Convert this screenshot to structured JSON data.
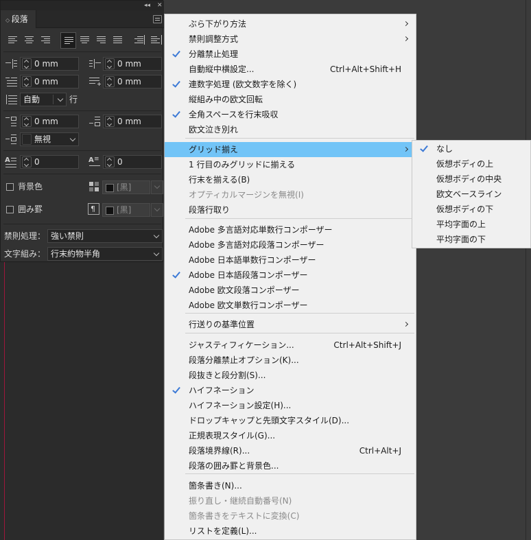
{
  "panel": {
    "title": "段落",
    "topbar_icons": [
      "collapse-icon",
      "close-icon"
    ],
    "indent_left": "0 mm",
    "indent_right": "0 mm",
    "indent_first": "0 mm",
    "indent_last": "0 mm",
    "leading_auto": "自動",
    "leading_unit": "行",
    "space_before": "0 mm",
    "space_after": "0 mm",
    "grid_align": "無視",
    "drop_cap_lines": "0",
    "drop_cap_chars": "0",
    "shading_label": "背景色",
    "shading_swatch": "[黒]",
    "border_label": "囲み罫",
    "border_swatch": "[黒]",
    "kinsoku_label": "禁則処理：",
    "kinsoku_value": "強い禁則",
    "mojikumi_label": "文字組み：",
    "mojikumi_value": "行末約物半角"
  },
  "menu": {
    "items": [
      {
        "label": "ぶら下がり方法",
        "submenu": true
      },
      {
        "label": "禁則調整方式",
        "submenu": true
      },
      {
        "label": "分離禁止処理",
        "checked": true
      },
      {
        "label": "自動縦中横設定...",
        "shortcut": "Ctrl+Alt+Shift+H"
      },
      {
        "label": "連数字処理 (欧文数字を除く)",
        "checked": true
      },
      {
        "label": "縦組み中の欧文回転"
      },
      {
        "label": "全角スペースを行末吸収",
        "checked": true
      },
      {
        "label": "欧文泣き別れ"
      },
      {
        "label": "グリッド揃え",
        "submenu": true,
        "highlighted": true
      },
      {
        "label": "1 行目のみグリッドに揃える"
      },
      {
        "label": "行末を揃える(B)"
      },
      {
        "label": "オプティカルマージンを無視(I)",
        "disabled": true
      },
      {
        "label": "段落行取り"
      },
      {
        "label": "Adobe 多言語対応単数行コンポーザー"
      },
      {
        "label": "Adobe 多言語対応段落コンポーザー"
      },
      {
        "label": "Adobe 日本語単数行コンポーザー"
      },
      {
        "label": "Adobe 日本語段落コンポーザー",
        "checked": true
      },
      {
        "label": "Adobe 欧文段落コンポーザー"
      },
      {
        "label": "Adobe 欧文単数行コンポーザー"
      },
      {
        "label": "行送りの基準位置",
        "submenu": true
      },
      {
        "label": "ジャスティフィケーション...",
        "shortcut": "Ctrl+Alt+Shift+J"
      },
      {
        "label": "段落分離禁止オプション(K)..."
      },
      {
        "label": "段抜きと段分割(S)..."
      },
      {
        "label": "ハイフネーション",
        "checked": true
      },
      {
        "label": "ハイフネーション設定(H)..."
      },
      {
        "label": "ドロップキャップと先頭文字スタイル(D)..."
      },
      {
        "label": "正規表現スタイル(G)..."
      },
      {
        "label": "段落境界線(R)...",
        "shortcut": "Ctrl+Alt+J"
      },
      {
        "label": "段落の囲み罫と背景色..."
      },
      {
        "label": "箇条書き(N)..."
      },
      {
        "label": "振り直し・継続自動番号(N)",
        "disabled": true
      },
      {
        "label": "箇条書きをテキストに変換(C)",
        "disabled": true
      },
      {
        "label": "リストを定義(L)..."
      }
    ]
  },
  "submenu": {
    "items": [
      {
        "label": "なし",
        "checked": true
      },
      {
        "label": "仮想ボディの上"
      },
      {
        "label": "仮想ボディの中央"
      },
      {
        "label": "欧文ベースライン"
      },
      {
        "label": "仮想ボディの下"
      },
      {
        "label": "平均字面の上"
      },
      {
        "label": "平均字面の下"
      }
    ]
  },
  "colors": {
    "highlight": "#72c4f7",
    "checkmark": "#3d7ad6",
    "panel_bg": "#323232",
    "menu_bg": "#f0f0f0"
  }
}
